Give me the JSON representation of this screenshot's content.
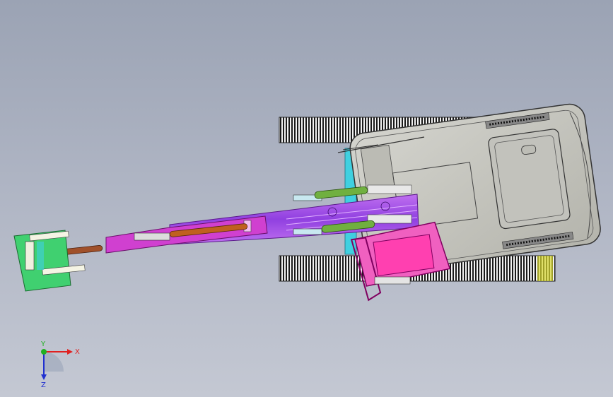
{
  "viewport": {
    "background_top": "#9ba3b4",
    "background_bottom": "#c4c8d3"
  },
  "triad": {
    "x_label": "X",
    "y_label": "Y",
    "z_label": "Z",
    "x_color": "#e02020",
    "y_color": "#20b020",
    "z_color": "#2030d0"
  },
  "model": {
    "cab_color": "#c8c8c2",
    "track_color": "#2a2a2a",
    "boom_color": "#a050e0",
    "stick_color": "#d040d0",
    "bucket_color": "#40d070",
    "operator_seat_color": "#e040a0",
    "cylinder_green": "#70b040",
    "cylinder_orange": "#c06020",
    "swing_color": "#40d0e0"
  }
}
